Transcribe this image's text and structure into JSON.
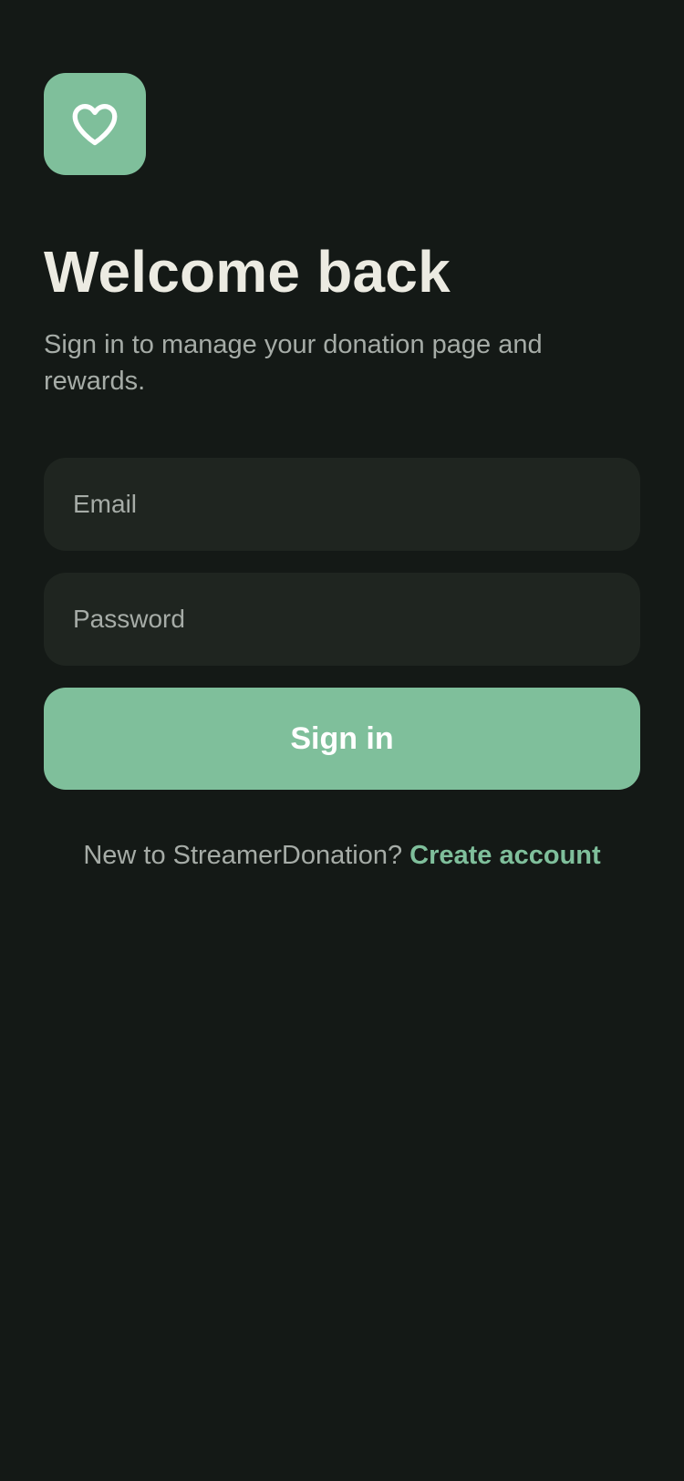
{
  "brand": {
    "accent_color": "#7fbf9b",
    "background_color": "#141916",
    "logo_icon": "heart-icon"
  },
  "header": {
    "title": "Welcome back",
    "subtitle": "Sign in to manage your donation page and rewards."
  },
  "form": {
    "email": {
      "placeholder": "Email",
      "value": ""
    },
    "password": {
      "placeholder": "Password",
      "value": ""
    },
    "submit_label": "Sign in"
  },
  "footer": {
    "prompt": "New to StreamerDonation? ",
    "link_label": "Create account"
  }
}
